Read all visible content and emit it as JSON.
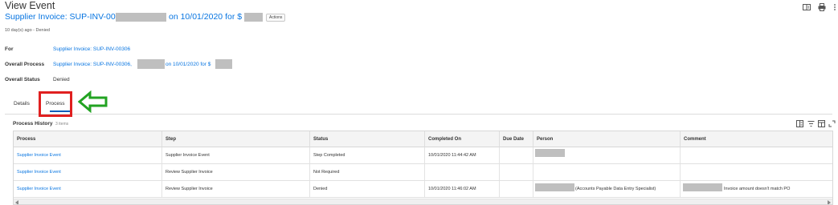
{
  "header": {
    "page_title": "View Event",
    "event_title_part1": "Supplier Invoice: SUP-INV-00306,",
    "event_title_part2": "on 10/01/2020 for $",
    "actions_label": "Actions",
    "subline": "10 day(s) ago - Denied",
    "icons": [
      "expand-panel-icon",
      "print-icon",
      "more-icon"
    ]
  },
  "details": {
    "for_label": "For",
    "for_value": "Supplier Invoice: SUP-INV-00306",
    "overall_process_label": "Overall Process",
    "overall_process_part1": "Supplier Invoice: SUP-INV-00306,",
    "overall_process_part2": "on 10/01/2020 for $",
    "overall_status_label": "Overall Status",
    "overall_status_value": "Denied"
  },
  "tabs": [
    {
      "label": "Details",
      "active": false
    },
    {
      "label": "Process",
      "active": true
    }
  ],
  "process_history": {
    "title": "Process History",
    "count": "3 items",
    "tool_icons": [
      "excel-export-icon",
      "filter-icon",
      "column-config-icon",
      "fullscreen-icon"
    ],
    "columns": [
      "Process",
      "Step",
      "Status",
      "Completed On",
      "Due Date",
      "Person",
      "Comment"
    ],
    "rows": [
      {
        "process": "Supplier Invoice Event",
        "step": "Supplier Invoice Event",
        "status": "Step Completed",
        "completed_on": "10/01/2020 11:44:42 AM",
        "due_date": "",
        "person": "",
        "comment": ""
      },
      {
        "process": "Supplier Invoice Event",
        "step": "Review Supplier Invoice",
        "status": "Not Required",
        "completed_on": "",
        "due_date": "",
        "person": "",
        "comment": ""
      },
      {
        "process": "Supplier Invoice Event",
        "step": "Review Supplier Invoice",
        "status": "Denied",
        "completed_on": "10/01/2020 11:46:02 AM",
        "due_date": "",
        "person": "(Accounts Payable Data Entry Specialist)",
        "comment": "Invoice amount doesn't match PO"
      }
    ]
  },
  "colors": {
    "link": "#0875e1",
    "highlight_box": "#e02020",
    "annotation_arrow": "#22a322",
    "tab_underline": "#005cb9",
    "redaction": "#bfbfbf"
  }
}
